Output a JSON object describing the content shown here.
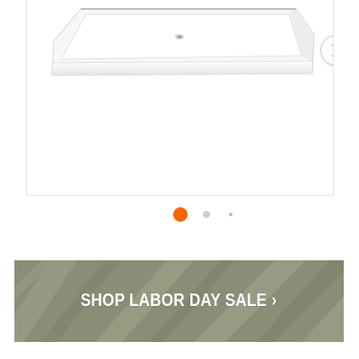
{
  "carousel": {
    "product_image_icon": "shower-base-image",
    "next_icon": "chevron-right-icon",
    "dot_count": 3,
    "active_index": 0,
    "colors": {
      "active_dot": "#f96302",
      "inactive_dot": "#cccccc"
    }
  },
  "promo": {
    "label": "SHOP LABOR DAY SALE",
    "chevron": "›",
    "colors": {
      "background": "#8d8f78",
      "text": "#ffffff"
    }
  }
}
